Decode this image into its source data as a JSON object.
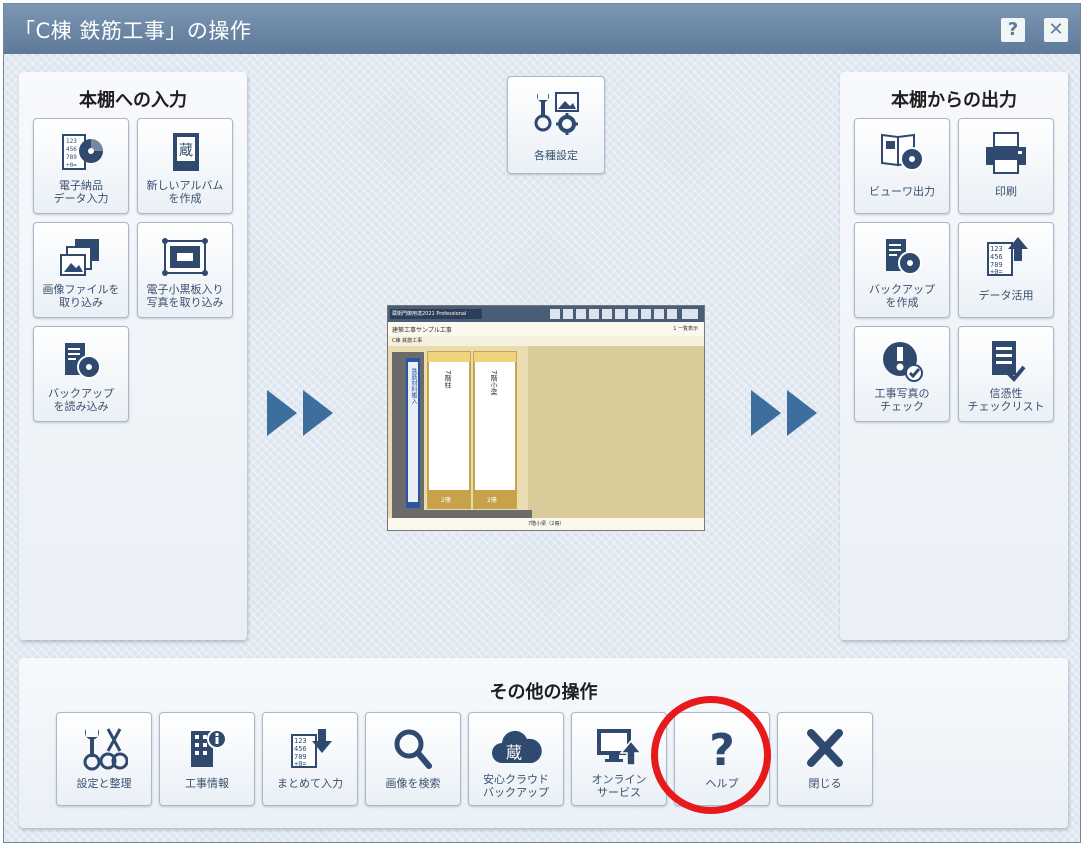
{
  "window": {
    "title": "「C棟 鉄筋工事」の操作",
    "help_button": "?",
    "close_button": "✕"
  },
  "input_panel": {
    "title": "本棚への入力",
    "tiles": [
      {
        "label": "電子納品\nデータ入力",
        "icon": "electronic-delivery-import-icon"
      },
      {
        "label": "新しいアルバム\nを作成",
        "icon": "new-album-icon"
      },
      {
        "label": "画像ファイルを\n取り込み",
        "icon": "image-import-icon"
      },
      {
        "label": "電子小黒板入り\n写真を取り込み",
        "icon": "blackboard-photo-icon"
      },
      {
        "label": "バックアップ\nを読み込み",
        "icon": "backup-load-icon"
      }
    ]
  },
  "center": {
    "settings_label": "各種設定",
    "settings_icon": "tools-settings-icon",
    "preview": {
      "app_title": "蔵衛門御用達2021 Professional",
      "breadcrumb": "建築工事サンプル工事",
      "right_label": "1 一覧表示",
      "tab_label": "C棟 鉄筋工事",
      "spine_main": "鉄筋材料搬入",
      "albums": [
        {
          "title": "7階柱",
          "count": "2冊"
        },
        {
          "title": "7階小梁",
          "count": "2冊"
        }
      ],
      "footer": "7階小梁（2冊）"
    }
  },
  "output_panel": {
    "title": "本棚からの出力",
    "tiles": [
      {
        "label": "ビューワ出力",
        "icon": "viewer-export-icon"
      },
      {
        "label": "印刷",
        "icon": "printer-icon"
      },
      {
        "label": "バックアップ\nを作成",
        "icon": "backup-create-icon"
      },
      {
        "label": "データ活用",
        "icon": "data-utilization-icon"
      },
      {
        "label": "工事写真の\nチェック",
        "icon": "photo-check-icon"
      },
      {
        "label": "信憑性\nチェックリスト",
        "icon": "authenticity-checklist-icon"
      }
    ]
  },
  "other_panel": {
    "title": "その他の操作",
    "buttons": [
      {
        "label": "設定と整理",
        "icon": "tools-icon"
      },
      {
        "label": "工事情報",
        "icon": "building-info-icon"
      },
      {
        "label": "まとめて入力",
        "icon": "batch-input-icon"
      },
      {
        "label": "画像を検索",
        "icon": "search-icon"
      },
      {
        "label": "安心クラウド\nバックアップ",
        "icon": "cloud-backup-icon"
      },
      {
        "label": "オンライン\nサービス",
        "icon": "online-service-icon"
      },
      {
        "label": "ヘルプ",
        "icon": "help-icon"
      },
      {
        "label": "閉じる",
        "icon": "close-icon"
      }
    ]
  },
  "colors": {
    "icon_blue": "#2f4a6e",
    "title_bar": "#6a86a5",
    "highlight_ring": "#e8191b",
    "arrow": "#3c6e9e"
  }
}
